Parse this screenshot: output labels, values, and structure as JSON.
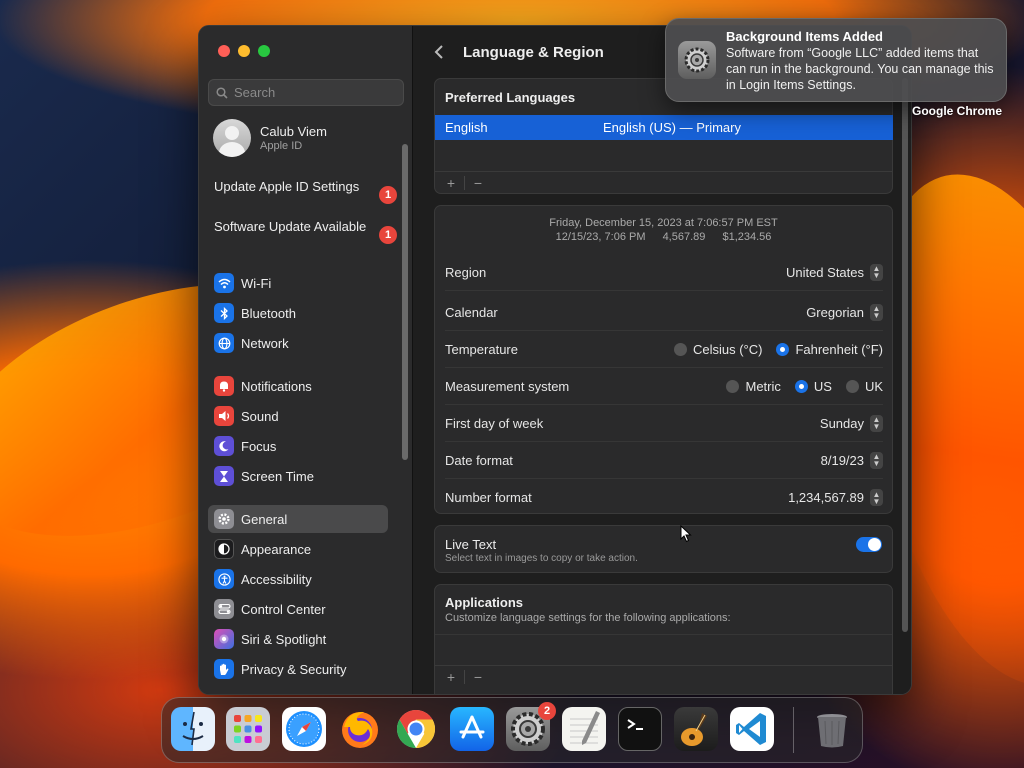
{
  "sidebar": {
    "search_placeholder": "Search",
    "account": {
      "name": "Calub Viem",
      "subtitle": "Apple ID"
    },
    "alerts": [
      {
        "label": "Update Apple ID Settings",
        "count": "1"
      },
      {
        "label": "Software Update Available",
        "count": "1"
      }
    ],
    "items": [
      {
        "label": "Wi-Fi",
        "icon": "wifi-icon",
        "color": "#1a73e8"
      },
      {
        "label": "Bluetooth",
        "icon": "bluetooth-icon",
        "color": "#1a73e8"
      },
      {
        "label": "Network",
        "icon": "globe-icon",
        "color": "#1a73e8"
      },
      {
        "label": "Notifications",
        "icon": "bell-icon",
        "color": "#e8453c"
      },
      {
        "label": "Sound",
        "icon": "speaker-icon",
        "color": "#e8453c"
      },
      {
        "label": "Focus",
        "icon": "moon-icon",
        "color": "#5e4fd6"
      },
      {
        "label": "Screen Time",
        "icon": "hourglass-icon",
        "color": "#5e4fd6"
      },
      {
        "label": "General",
        "icon": "gear-icon",
        "color": "#8e8e93"
      },
      {
        "label": "Appearance",
        "icon": "appearance-icon",
        "color": "#1c1c1e"
      },
      {
        "label": "Accessibility",
        "icon": "accessibility-icon",
        "color": "#1a73e8"
      },
      {
        "label": "Control Center",
        "icon": "control-center-icon",
        "color": "#8e8e93"
      },
      {
        "label": "Siri & Spotlight",
        "icon": "siri-icon",
        "color": "#b04fd6"
      },
      {
        "label": "Privacy & Security",
        "icon": "hand-icon",
        "color": "#1a73e8"
      }
    ],
    "selected": "General"
  },
  "main": {
    "title": "Language & Region",
    "preferred_languages": {
      "header": "Preferred Languages",
      "rows": [
        {
          "name": "English",
          "detail": "English (US) — Primary"
        }
      ],
      "add_label": "+",
      "remove_label": "−"
    },
    "preview": {
      "line1": "Friday, December 15, 2023 at 7:06:57 PM EST",
      "line2": [
        "12/15/23, 7:06 PM",
        "4,567.89",
        "$1,234.56"
      ]
    },
    "region": {
      "label": "Region",
      "value": "United States"
    },
    "calendar": {
      "label": "Calendar",
      "value": "Gregorian"
    },
    "temperature": {
      "label": "Temperature",
      "options": [
        "Celsius (°C)",
        "Fahrenheit (°F)"
      ],
      "selected": "Fahrenheit (°F)"
    },
    "measurement": {
      "label": "Measurement system",
      "options": [
        "Metric",
        "US",
        "UK"
      ],
      "selected": "US"
    },
    "first_day": {
      "label": "First day of week",
      "value": "Sunday"
    },
    "date_format": {
      "label": "Date format",
      "value": "8/19/23"
    },
    "number_format": {
      "label": "Number format",
      "value": "1,234,567.89"
    },
    "live_text": {
      "label": "Live Text",
      "description": "Select text in images to copy or take action.",
      "enabled": true
    },
    "applications": {
      "title": "Applications",
      "description": "Customize language settings for the following applications:",
      "add_label": "+",
      "remove_label": "−"
    }
  },
  "notification": {
    "title": "Background Items Added",
    "body": "Software from “Google LLC” added items that can run in the background. You can manage this in Login Items Settings."
  },
  "desktop_label": "Google Chrome",
  "dock": {
    "apps": [
      {
        "name": "Finder",
        "icon": "finder-icon",
        "badge": ""
      },
      {
        "name": "Launchpad",
        "icon": "launchpad-icon",
        "badge": ""
      },
      {
        "name": "Safari",
        "icon": "safari-icon",
        "badge": ""
      },
      {
        "name": "Firefox",
        "icon": "firefox-icon",
        "badge": ""
      },
      {
        "name": "Google Chrome",
        "icon": "chrome-icon",
        "badge": ""
      },
      {
        "name": "App Store",
        "icon": "app-store-icon",
        "badge": ""
      },
      {
        "name": "System Settings",
        "icon": "system-settings-icon",
        "badge": "2"
      },
      {
        "name": "TextEdit",
        "icon": "textedit-icon",
        "badge": ""
      },
      {
        "name": "Terminal",
        "icon": "terminal-icon",
        "badge": ""
      },
      {
        "name": "GarageBand",
        "icon": "garageband-icon",
        "badge": ""
      },
      {
        "name": "Visual Studio Code",
        "icon": "vscode-icon",
        "badge": ""
      },
      {
        "name": "Trash",
        "icon": "trash-icon",
        "badge": ""
      }
    ]
  },
  "colors": {
    "accent": "#1a73e8",
    "selection": "#1761d6",
    "badge": "#e8453c"
  }
}
